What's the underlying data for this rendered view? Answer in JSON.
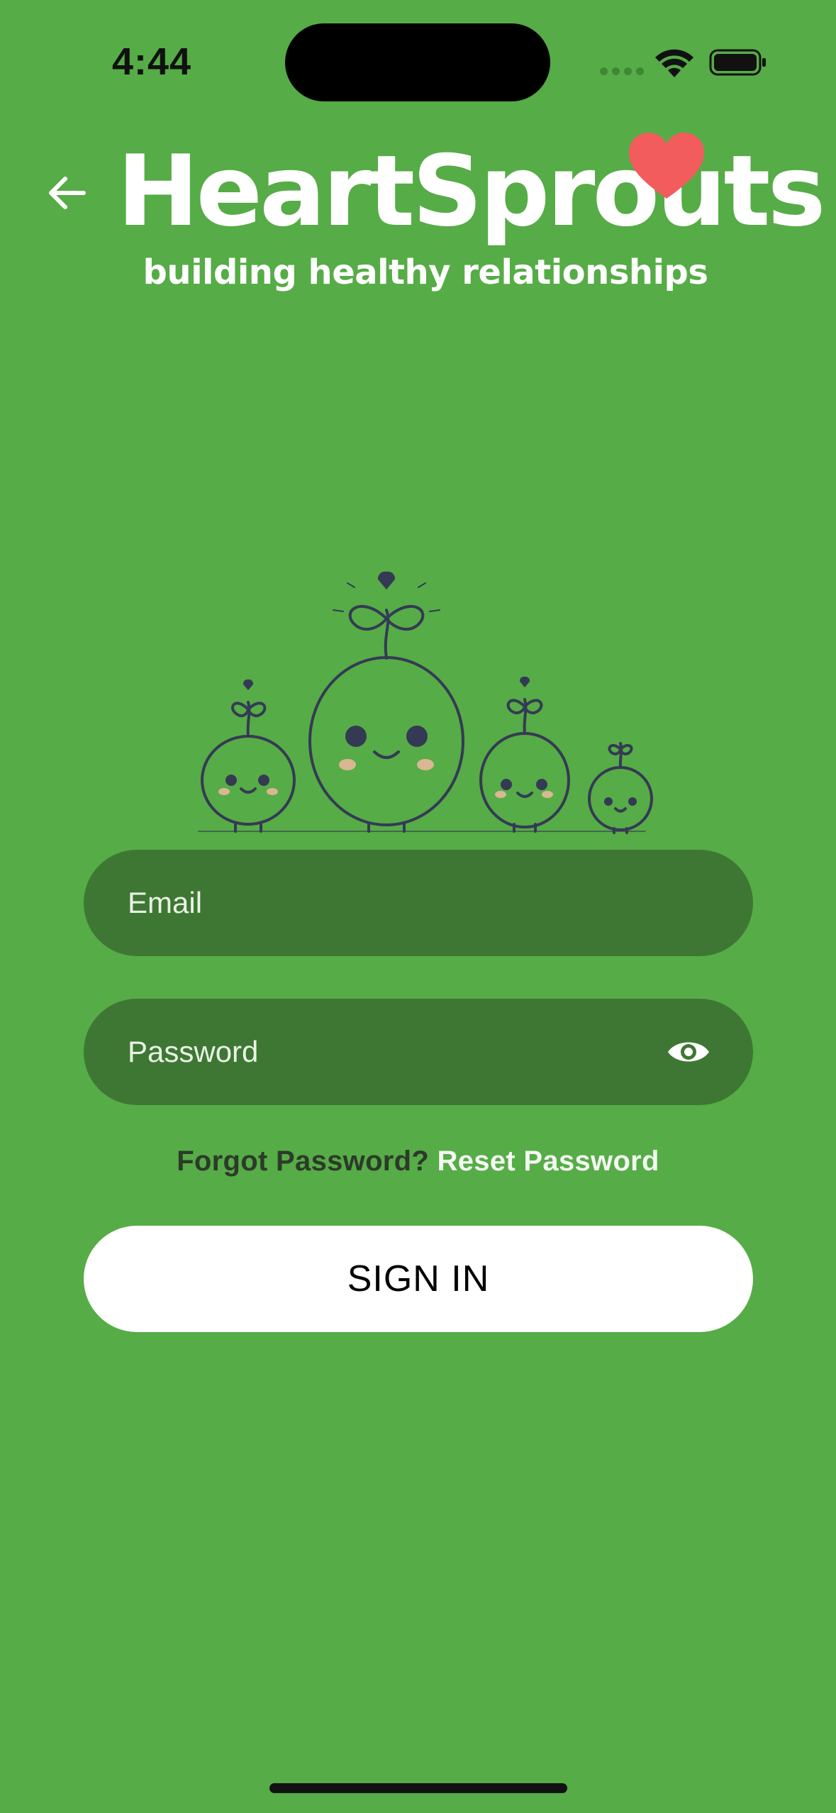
{
  "status_bar": {
    "time": "4:44",
    "icons": [
      "cellular-signal-icon",
      "wifi-icon",
      "battery-icon"
    ]
  },
  "header": {
    "back_icon": "arrow-left-icon",
    "app_name": "HeartSprouts",
    "tagline": "building healthy relationships",
    "logo_heart_color": "#F25C5C"
  },
  "illustration": {
    "name": "sprout-family-illustration"
  },
  "form": {
    "email": {
      "placeholder": "Email",
      "value": ""
    },
    "password": {
      "placeholder": "Password",
      "value": "",
      "toggle_icon": "eye-icon"
    },
    "forgot_text": "Forgot Password?",
    "reset_link": "Reset Password",
    "sign_in_label": "SIGN IN"
  },
  "colors": {
    "background": "#56AC46",
    "field_background": "#3E7733",
    "button_background": "#FFFFFF",
    "illustration_stroke": "#343A54"
  }
}
